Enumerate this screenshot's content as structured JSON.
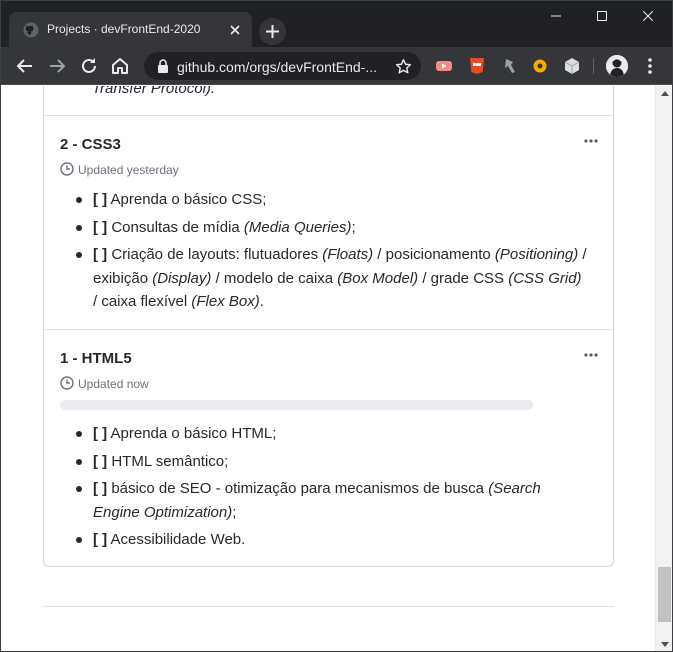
{
  "browser": {
    "tab_title": "Projects · devFrontEnd-2020",
    "url": "github.com/orgs/devFrontEnd-...",
    "icons": [
      "github-favicon",
      "close-icon",
      "plus-icon",
      "minimize-icon",
      "maximize-icon",
      "window-close-icon",
      "back-arrow-icon",
      "forward-arrow-icon",
      "reload-icon",
      "home-icon",
      "lock-icon",
      "star-icon",
      "kebab-menu-icon"
    ]
  },
  "column": {
    "prev_note_tail": "Transfer Protocol).",
    "notes": [
      {
        "title": "2 - CSS3",
        "updated": "Updated yesterday",
        "items": [
          {
            "check": "[ ]",
            "parts": [
              {
                "t": " Aprenda o básico CSS;"
              }
            ]
          },
          {
            "check": "[ ]",
            "parts": [
              {
                "t": " Consultas de mídia "
              },
              {
                "t": "(Media Queries)",
                "i": true
              },
              {
                "t": ";"
              }
            ]
          },
          {
            "check": "[ ]",
            "parts": [
              {
                "t": " Criação de layouts: flutuadores "
              },
              {
                "t": "(Floats)",
                "i": true
              },
              {
                "t": " / posicionamento "
              },
              {
                "t": "(Positioning)",
                "i": true
              },
              {
                "t": " / exibição "
              },
              {
                "t": "(Display)",
                "i": true
              },
              {
                "t": " / modelo de caixa "
              },
              {
                "t": "(Box Model)",
                "i": true
              },
              {
                "t": " / grade CSS "
              },
              {
                "t": "(CSS Grid)",
                "i": true
              },
              {
                "t": " / caixa flexível "
              },
              {
                "t": "(Flex Box)",
                "i": true
              },
              {
                "t": "."
              }
            ]
          }
        ]
      },
      {
        "title": "1 - HTML5",
        "updated": "Updated now",
        "items": [
          {
            "check": "[ ]",
            "parts": [
              {
                "t": " Aprenda o básico HTML;"
              }
            ]
          },
          {
            "check": "[ ]",
            "parts": [
              {
                "t": " HTML semântico;"
              }
            ]
          },
          {
            "check": "[ ]",
            "parts": [
              {
                "t": " básico de SEO - otimização para mecanismos de busca "
              },
              {
                "t": "(Search Engine Optimization)",
                "i": true
              },
              {
                "t": ";"
              }
            ]
          },
          {
            "check": "[ ]",
            "parts": [
              {
                "t": " Acessibilidade Web."
              }
            ]
          }
        ]
      }
    ]
  },
  "colors": {
    "chrome_dark": "#202124",
    "chrome_tab": "#35363a",
    "text": "#24292e",
    "muted": "#6a737d",
    "border": "#d1d5da"
  }
}
